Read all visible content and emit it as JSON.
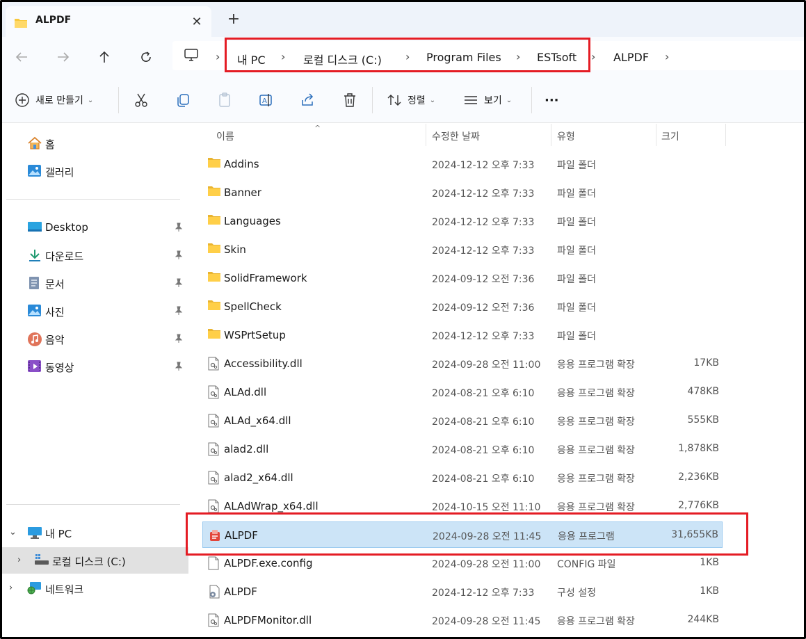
{
  "tab": {
    "title": "ALPDF",
    "close": "✕",
    "add": "+"
  },
  "nav": {
    "back": "←",
    "forward": "→",
    "up": "↑",
    "refresh": "⟳",
    "breadcrumb": [
      "내 PC",
      "로컬 디스크 (C:)",
      "Program Files",
      "ESTsoft",
      "ALPDF"
    ],
    "separator": "›"
  },
  "toolbar": {
    "new_label": "새로 만들기",
    "sort_label": "정렬",
    "view_label": "보기",
    "more_label": "···",
    "icons": [
      "cut-icon",
      "copy-icon",
      "paste-icon",
      "rename-icon",
      "share-icon",
      "delete-icon"
    ]
  },
  "sidebar": {
    "top": [
      {
        "label": "홈",
        "icon": "home-icon"
      },
      {
        "label": "갤러리",
        "icon": "gallery-icon"
      }
    ],
    "quick": [
      {
        "label": "Desktop",
        "icon": "desktop-icon"
      },
      {
        "label": "다운로드",
        "icon": "download-icon"
      },
      {
        "label": "문서",
        "icon": "documents-icon"
      },
      {
        "label": "사진",
        "icon": "pictures-icon"
      },
      {
        "label": "음악",
        "icon": "music-icon"
      },
      {
        "label": "동영상",
        "icon": "videos-icon"
      }
    ],
    "tree": [
      {
        "label": "내 PC",
        "icon": "pc-icon",
        "caret": "⌄"
      },
      {
        "label": "로컬 디스크 (C:)",
        "icon": "drive-icon",
        "caret": "›"
      },
      {
        "label": "네트워크",
        "icon": "network-icon",
        "caret": "›"
      }
    ]
  },
  "columns": {
    "name": "이름",
    "date": "수정한 날짜",
    "type": "유형",
    "size": "크기",
    "sort_arrow": "^"
  },
  "files": [
    {
      "name": "Addins",
      "date": "2024-12-12 오후 7:33",
      "type": "파일 폴더",
      "size": "",
      "icon": "folder"
    },
    {
      "name": "Banner",
      "date": "2024-12-12 오후 7:33",
      "type": "파일 폴더",
      "size": "",
      "icon": "folder"
    },
    {
      "name": "Languages",
      "date": "2024-12-12 오후 7:33",
      "type": "파일 폴더",
      "size": "",
      "icon": "folder"
    },
    {
      "name": "Skin",
      "date": "2024-12-12 오후 7:33",
      "type": "파일 폴더",
      "size": "",
      "icon": "folder"
    },
    {
      "name": "SolidFramework",
      "date": "2024-09-12 오전 7:36",
      "type": "파일 폴더",
      "size": "",
      "icon": "folder"
    },
    {
      "name": "SpellCheck",
      "date": "2024-09-12 오전 7:36",
      "type": "파일 폴더",
      "size": "",
      "icon": "folder"
    },
    {
      "name": "WSPrtSetup",
      "date": "2024-12-12 오후 7:33",
      "type": "파일 폴더",
      "size": "",
      "icon": "folder"
    },
    {
      "name": "Accessibility.dll",
      "date": "2024-09-28 오전 11:00",
      "type": "응용 프로그램 확장",
      "size": "17KB",
      "icon": "dll"
    },
    {
      "name": "ALAd.dll",
      "date": "2024-08-21 오후 6:10",
      "type": "응용 프로그램 확장",
      "size": "478KB",
      "icon": "dll"
    },
    {
      "name": "ALAd_x64.dll",
      "date": "2024-08-21 오후 6:10",
      "type": "응용 프로그램 확장",
      "size": "555KB",
      "icon": "dll"
    },
    {
      "name": "alad2.dll",
      "date": "2024-08-21 오후 6:10",
      "type": "응용 프로그램 확장",
      "size": "1,878KB",
      "icon": "dll"
    },
    {
      "name": "alad2_x64.dll",
      "date": "2024-08-21 오후 6:10",
      "type": "응용 프로그램 확장",
      "size": "2,236KB",
      "icon": "dll"
    },
    {
      "name": "ALAdWrap_x64.dll",
      "date": "2024-10-15 오전 11:10",
      "type": "응용 프로그램 확장",
      "size": "2,776KB",
      "icon": "dll"
    },
    {
      "name": "ALPDF",
      "date": "2024-09-28 오전 11:45",
      "type": "응용 프로그램",
      "size": "31,655KB",
      "icon": "app",
      "selected": true
    },
    {
      "name": "ALPDF.exe.config",
      "date": "2024-09-28 오전 11:00",
      "type": "CONFIG 파일",
      "size": "1KB",
      "icon": "file"
    },
    {
      "name": "ALPDF",
      "date": "2024-12-12 오후 7:33",
      "type": "구성 설정",
      "size": "1KB",
      "icon": "config"
    },
    {
      "name": "ALPDFMonitor.dll",
      "date": "2024-09-28 오전 11:45",
      "type": "응용 프로그램 확장",
      "size": "244KB",
      "icon": "dll"
    }
  ],
  "highlight_color": "#e41c24",
  "selection_color": "#cce4f7"
}
